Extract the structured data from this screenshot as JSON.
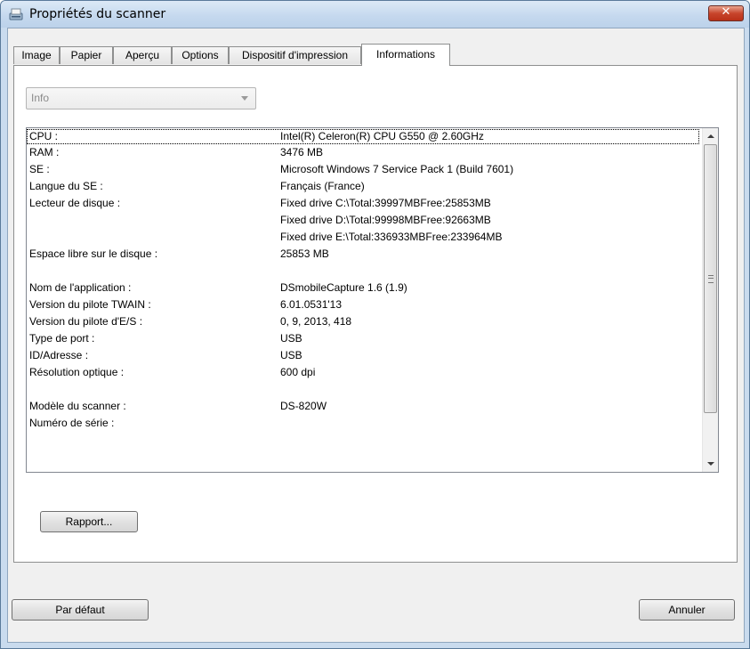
{
  "window": {
    "title": "Propriétés du scanner",
    "close_glyph": "✕"
  },
  "tabs": [
    {
      "label": "Image"
    },
    {
      "label": "Papier"
    },
    {
      "label": "Aperçu"
    },
    {
      "label": "Options"
    },
    {
      "label": "Dispositif d'impression"
    },
    {
      "label": "Informations",
      "active": true
    }
  ],
  "combo": {
    "value": "Info"
  },
  "info_rows": [
    {
      "key": "CPU :",
      "value": "Intel(R) Celeron(R) CPU G550 @ 2.60GHz"
    },
    {
      "key": "RAM :",
      "value": "3476 MB"
    },
    {
      "key": "SE :",
      "value": "Microsoft Windows 7 Service Pack 1 (Build 7601)"
    },
    {
      "key": "Langue du SE :",
      "value": "Français (France)"
    },
    {
      "key": "Lecteur de disque :",
      "value": "Fixed drive C:\\Total:39997MBFree:25853MB"
    },
    {
      "key": "",
      "value": "Fixed drive D:\\Total:99998MBFree:92663MB"
    },
    {
      "key": "",
      "value": "Fixed drive E:\\Total:336933MBFree:233964MB"
    },
    {
      "key": "Espace libre sur le disque :",
      "value": "25853 MB"
    },
    {
      "key": "",
      "value": ""
    },
    {
      "key": "Nom de l'application :",
      "value": " DSmobileCapture 1.6 (1.9)"
    },
    {
      "key": "Version du pilote TWAIN :",
      "value": "6.01.0531'13"
    },
    {
      "key": "Version du pilote d'E/S :",
      "value": "0, 9, 2013, 418"
    },
    {
      "key": "Type de port :",
      "value": "USB"
    },
    {
      "key": "ID/Adresse :",
      "value": "USB"
    },
    {
      "key": "Résolution optique :",
      "value": "600 dpi"
    },
    {
      "key": "",
      "value": ""
    },
    {
      "key": "Modèle du scanner :",
      "value": "DS-820W"
    },
    {
      "key": "Numéro de série :",
      "value": ""
    }
  ],
  "buttons": {
    "report": "Rapport...",
    "default": "Par défaut",
    "cancel": "Annuler"
  },
  "icons": {
    "app": "scanner-icon",
    "combo_arrow": "chevron-down-icon",
    "scroll_up": "scroll-up-arrow-icon",
    "scroll_down": "scroll-down-arrow-icon"
  }
}
